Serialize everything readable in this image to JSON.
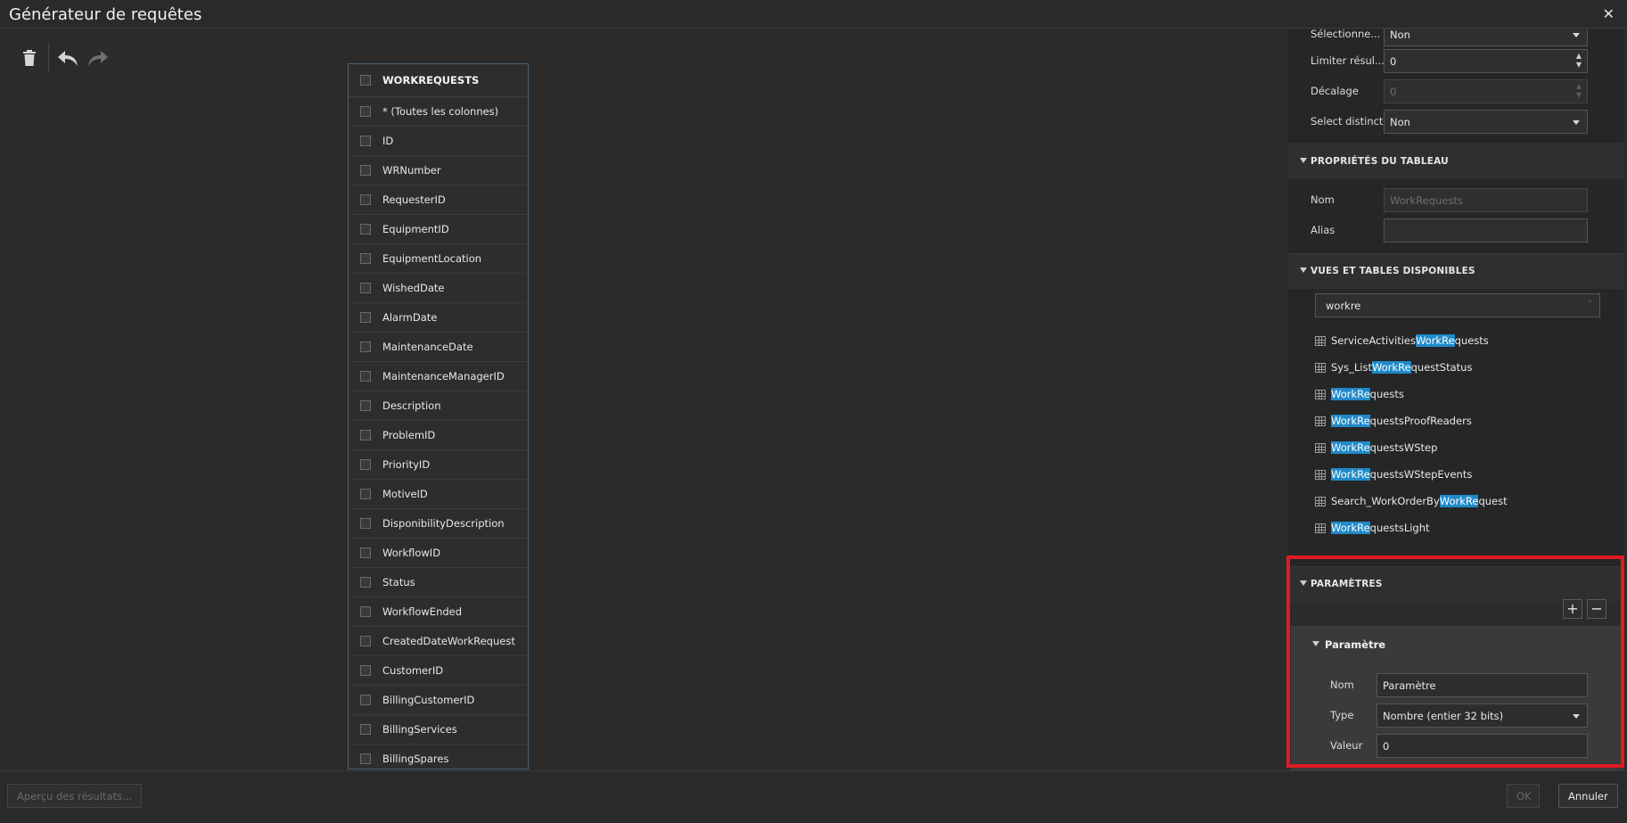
{
  "window": {
    "title": "Générateur de requêtes",
    "close_glyph": "✕"
  },
  "toolbar": {
    "items": [
      {
        "icon": "trash-icon"
      },
      {
        "icon": "undo-icon"
      },
      {
        "icon": "redo-icon"
      }
    ]
  },
  "table_card": {
    "name": "WORKREQUESTS",
    "columns": [
      "* (Toutes les colonnes)",
      "ID",
      "WRNumber",
      "RequesterID",
      "EquipmentID",
      "EquipmentLocation",
      "WishedDate",
      "AlarmDate",
      "MaintenanceDate",
      "MaintenanceManagerID",
      "Description",
      "ProblemID",
      "PriorityID",
      "MotiveID",
      "DisponibilityDescription",
      "WorkflowID",
      "Status",
      "WorkflowEnded",
      "CreatedDateWorkRequest",
      "CustomerID",
      "BillingCustomerID",
      "BillingServices",
      "BillingSpares"
    ]
  },
  "query_props": {
    "select_label": "Sélectionne...",
    "select_value": "Non",
    "limit_label": "Limiter résul...",
    "limit_value": "0",
    "offset_label": "Décalage",
    "offset_value": "0",
    "distinct_label": "Select distinct",
    "distinct_value": "Non"
  },
  "table_props": {
    "header": "PROPRIÉTÉS DU TABLEAU",
    "name_label": "Nom",
    "name_value": "WorkRequests",
    "alias_label": "Alias",
    "alias_value": ""
  },
  "available": {
    "header": "VUES ET TABLES DISPONIBLES",
    "search_value": "workre",
    "items": [
      {
        "pre": "ServiceActivities",
        "hl": "WorkRe",
        "post": "quests"
      },
      {
        "pre": "Sys_List",
        "hl": "WorkRe",
        "post": "questStatus"
      },
      {
        "pre": "",
        "hl": "WorkRe",
        "post": "quests"
      },
      {
        "pre": "",
        "hl": "WorkRe",
        "post": "questsProofReaders"
      },
      {
        "pre": "",
        "hl": "WorkRe",
        "post": "questsWStep"
      },
      {
        "pre": "",
        "hl": "WorkRe",
        "post": "questsWStepEvents"
      },
      {
        "pre": "Search_WorkOrderBy",
        "hl": "WorkRe",
        "post": "quest"
      },
      {
        "pre": "",
        "hl": "WorkRe",
        "post": "questsLight"
      }
    ]
  },
  "parameters": {
    "header": "PARAMÈTRES",
    "add_label": "+",
    "remove_label": "−",
    "item_title": "Paramètre",
    "name_label": "Nom",
    "name_value": "Paramètre",
    "type_label": "Type",
    "type_value": "Nombre (entier 32 bits)",
    "value_label": "Valeur",
    "value_value": "0"
  },
  "footer": {
    "preview_label": "Aperçu des résultats...",
    "ok_label": "OK",
    "cancel_label": "Annuler"
  },
  "colors": {
    "accent": "#1f8ac9",
    "highlight_box": "#e01a22"
  }
}
